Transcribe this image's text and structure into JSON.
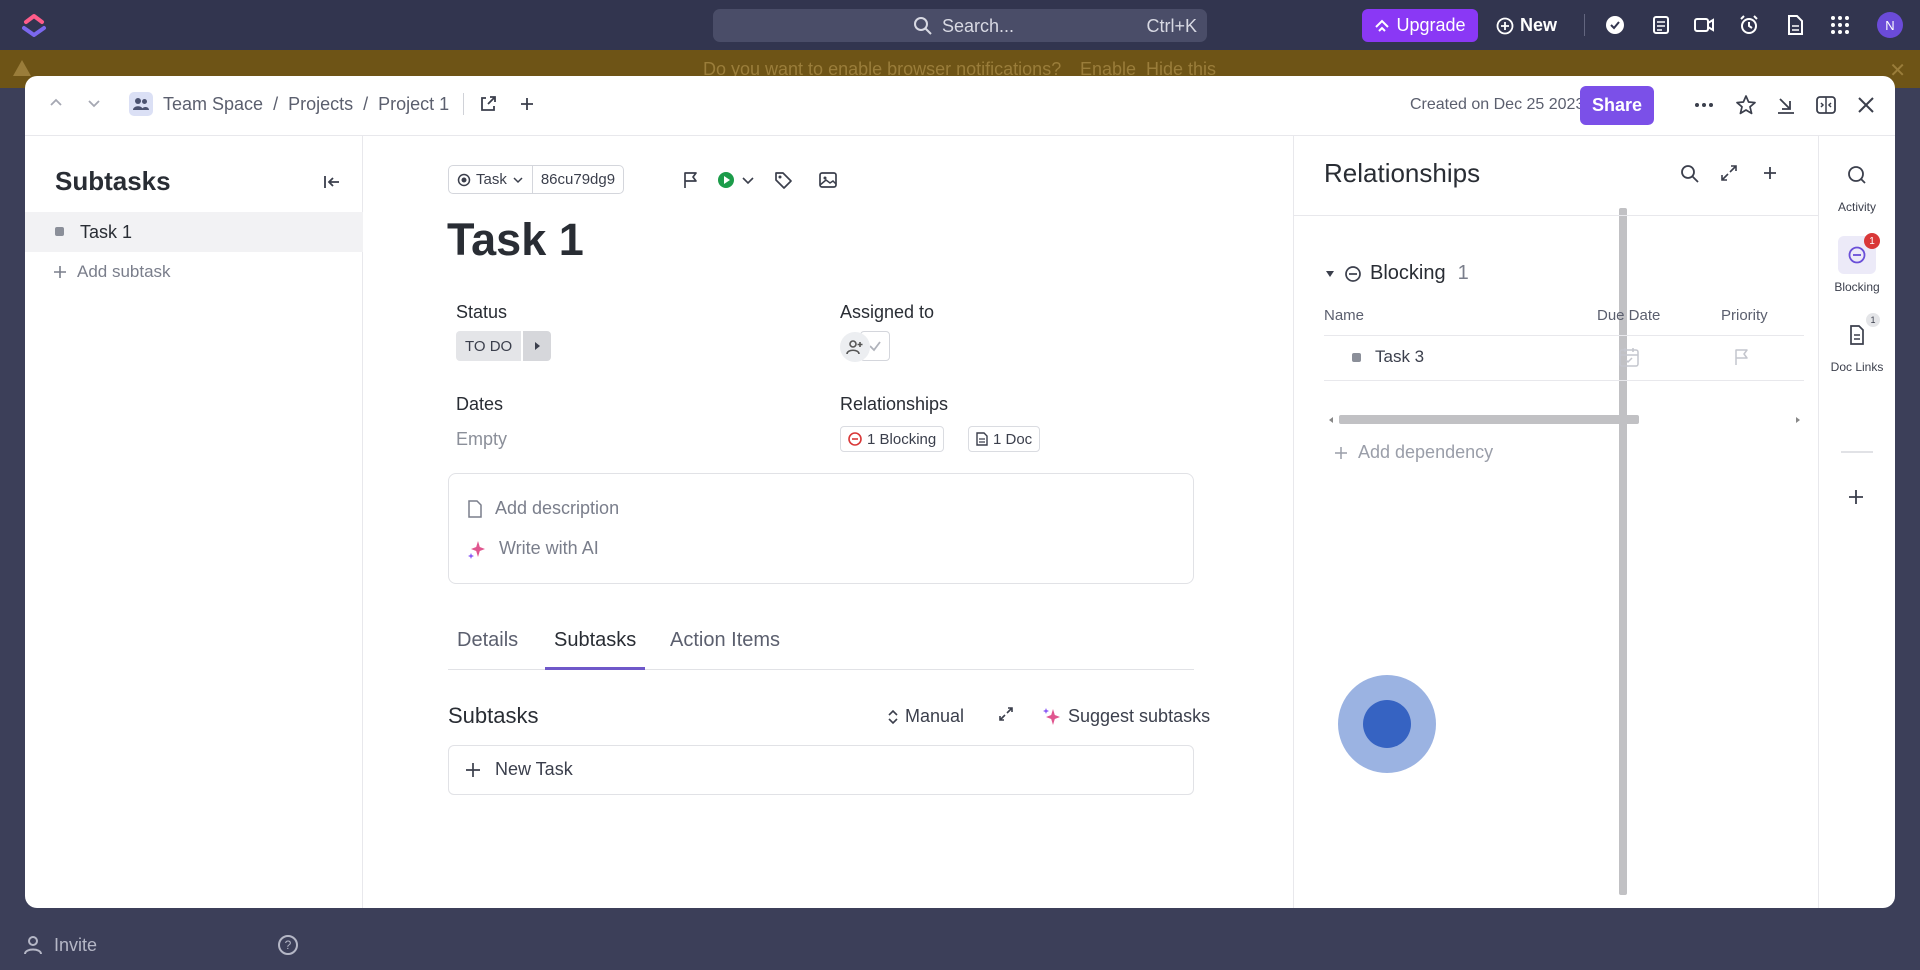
{
  "topbar": {
    "search_placeholder": "Search...",
    "search_shortcut": "Ctrl+K",
    "upgrade_label": "Upgrade",
    "new_label": "New",
    "avatar_initial": "N"
  },
  "notification": {
    "text": "Do you want to enable browser notifications?",
    "enable_label": "Enable",
    "hide_label": "Hide this"
  },
  "background": {
    "invite_label": "Invite"
  },
  "modal": {
    "breadcrumb": [
      "Team Space",
      "Projects",
      "Project 1"
    ],
    "created": "Created on Dec 25 2023",
    "share_label": "Share"
  },
  "left_pane": {
    "title": "Subtasks",
    "task_name": "Task 1",
    "add_subtask_label": "Add subtask"
  },
  "task": {
    "type_label": "Task",
    "id": "86cu79dg9",
    "title": "Task 1",
    "status_label": "Status",
    "status_value": "TO DO",
    "assigned_label": "Assigned to",
    "dates_label": "Dates",
    "dates_value": "Empty",
    "relationships_label": "Relationships",
    "blocking_chip": "1 Blocking",
    "doc_chip": "1 Doc",
    "add_description": "Add description",
    "write_ai": "Write with AI",
    "tabs": [
      "Details",
      "Subtasks",
      "Action Items"
    ],
    "active_tab": "Subtasks",
    "subtasks_heading": "Subtasks",
    "manual_label": "Manual",
    "suggest_label": "Suggest subtasks",
    "new_task_label": "New Task"
  },
  "relationships_panel": {
    "title": "Relationships",
    "group_label": "Blocking",
    "group_count": "1",
    "columns": [
      "Name",
      "Due Date",
      "Priority"
    ],
    "rows": [
      {
        "name": "Task 3"
      }
    ],
    "add_dependency": "Add dependency"
  },
  "rail": {
    "items": [
      {
        "label": "Activity",
        "icon": "chat-search-icon",
        "badge": ""
      },
      {
        "label": "Blocking",
        "icon": "blocking-icon",
        "badge": "1"
      },
      {
        "label": "Doc Links",
        "icon": "doc-icon",
        "badge": "1"
      }
    ]
  },
  "colors": {
    "topbar": "#32354f",
    "upgrade": "#8a38f5",
    "share": "#7b50e8",
    "accent_tab": "#6f58c9",
    "blocking_red": "#d93838"
  }
}
